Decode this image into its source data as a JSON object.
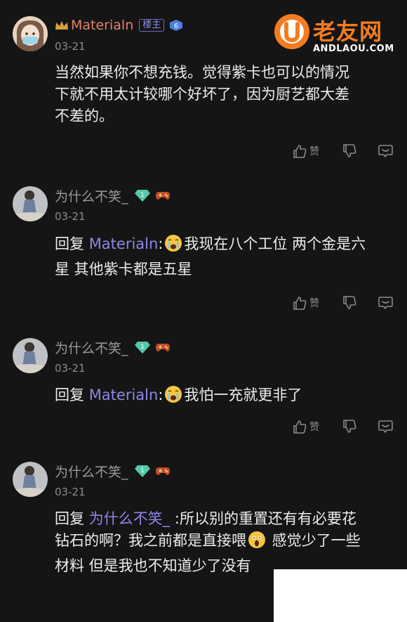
{
  "watermark": {
    "title": "老友网",
    "domain": "ANDLAOU.COM"
  },
  "like_label": "赞",
  "comments": [
    {
      "user": "Materialn",
      "badge": "楼主",
      "level": "6",
      "date": "03-21",
      "lines": [
        "当然如果你不想充钱。觉得紫卡也可以的情况",
        "下就不用太计较哪个好坏了，因为厨艺都大差",
        "不差的。"
      ]
    },
    {
      "user": "为什么不笑_",
      "level": "1",
      "date": "03-21",
      "reply_prefix": "回复",
      "mention": "Materialn",
      "colon": ":",
      "text1": "我现在八个工位 两个金是六",
      "text2": "星 其他紫卡都是五星"
    },
    {
      "user": "为什么不笑_",
      "level": "1",
      "date": "03-21",
      "reply_prefix": "回复",
      "mention": "Materialn",
      "colon": ":",
      "text1": "我怕一充就更非了"
    },
    {
      "user": "为什么不笑_",
      "level": "1",
      "date": "03-21",
      "reply_prefix": "回复",
      "mention": "为什么不笑_",
      "text1": " :所以别的重置还有有必要花",
      "text2a": "钻石的啊？我之前都是直接喂",
      "text2b": " 感觉少了一些",
      "text3": "材料 但是我也不知道少了没有"
    }
  ],
  "colors": {
    "background": "#151515",
    "op_name": "#e4826a",
    "mention": "#8f86e8",
    "gem": "#53c9a8",
    "logo": "#f47c20"
  }
}
